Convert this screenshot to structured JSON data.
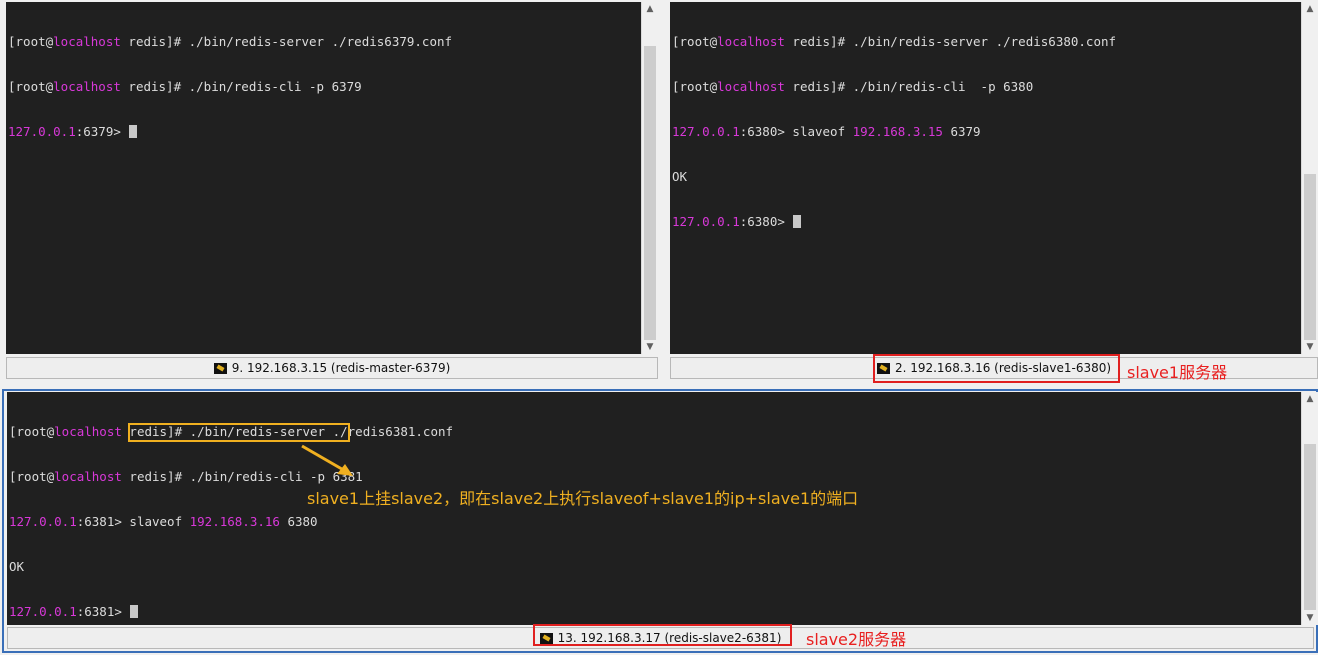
{
  "panes": {
    "master": {
      "lines": [
        {
          "prefix": "[root@",
          "host": "localhost",
          "rest": " redis]# ./bin/redis-server ./redis6379.conf"
        },
        {
          "prefix": "[root@",
          "host": "localhost",
          "rest": " redis]# ./bin/redis-cli -p 6379"
        }
      ],
      "prompt_ip": "127.0.0.1",
      "prompt_rest": ":6379> ",
      "status": "9. 192.168.3.15 (redis-master-6379)"
    },
    "slave1": {
      "lines": [
        {
          "prefix": "[root@",
          "host": "localhost",
          "rest": " redis]# ./bin/redis-server ./redis6380.conf"
        },
        {
          "prefix": "[root@",
          "host": "localhost",
          "rest": " redis]# ./bin/redis-cli  -p 6380"
        }
      ],
      "cmd_prompt_ip": "127.0.0.1",
      "cmd_prompt_rest": ":6380> ",
      "cmd_text": "slaveof ",
      "cmd_ip": "192.168.3.15",
      "cmd_port": " 6379",
      "ok": "OK",
      "prompt_ip": "127.0.0.1",
      "prompt_rest": ":6380> ",
      "status": "2. 192.168.3.16 (redis-slave1-6380)"
    },
    "slave2": {
      "lines": [
        {
          "prefix": "[root@",
          "host": "localhost",
          "rest": " redis]# ./bin/redis-server ./redis6381.conf"
        },
        {
          "prefix": "[root@",
          "host": "localhost",
          "rest": " redis]# ./bin/redis-cli -p 6381"
        }
      ],
      "cmd_prompt_ip": "127.0.0.1",
      "cmd_prompt_rest": ":6381>",
      "cmd_text": " slaveof ",
      "cmd_ip": "192.168.3.16",
      "cmd_port": " 6380",
      "ok": "OK",
      "prompt_ip": "127.0.0.1",
      "prompt_rest": ":6381> ",
      "status": "13. 192.168.3.17 (redis-slave2-6381)"
    }
  },
  "annotations": {
    "slave1_label": "slave1服务器",
    "slave2_label": "slave2服务器",
    "note": "slave1上挂slave2，即在slave2上执行slaveof+slave1的ip+slave1的端口"
  },
  "colors": {
    "terminal_bg": "#202020",
    "host_magenta": "#d838d8",
    "highlight_red": "#e02020",
    "highlight_yellow": "#f0b020",
    "active_border": "#3a6fb8"
  },
  "icons": {
    "status": "key-icon",
    "scroll_up": "arrow-up-icon",
    "scroll_down": "arrow-down-icon"
  }
}
